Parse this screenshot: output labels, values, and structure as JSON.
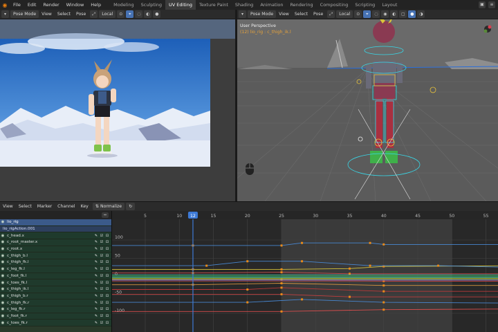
{
  "menubar": {
    "items": [
      "File",
      "Edit",
      "Render",
      "Window",
      "Help"
    ],
    "workspaces": [
      "Modeling",
      "Sculpting",
      "UV Editing",
      "Texture Paint",
      "Shading",
      "Animation",
      "Rendering",
      "Compositing",
      "Scripting",
      "Layout"
    ],
    "active_workspace": "UV Editing"
  },
  "left_viewport": {
    "mode": "Pose Mode",
    "menus": [
      "View",
      "Select",
      "Pose"
    ],
    "orientation": "Local"
  },
  "right_viewport": {
    "mode": "Pose Mode",
    "menus": [
      "View",
      "Select",
      "Pose"
    ],
    "orientation": "Local",
    "overlay_title": "User Perspective",
    "overlay_subtitle": "(12) lio_rig : c_thigh_ik.l"
  },
  "graph_editor": {
    "menus": [
      "View",
      "Select",
      "Marker",
      "Channel",
      "Key"
    ],
    "normalize_label": "Normalize",
    "current_frame": "12",
    "frame_ticks": [
      "5",
      "10",
      "12",
      "15",
      "20",
      "25",
      "30",
      "35",
      "40",
      "45",
      "50",
      "55"
    ],
    "value_ticks": [
      "100",
      "50",
      "0",
      "-50",
      "-100"
    ],
    "object": "lio_rig",
    "action": "lio_rigAction.001",
    "channels": [
      "c_head.x",
      "c_root_master.x",
      "c_root.x",
      "c_thigh_b.l",
      "c_thigh_fk.l",
      "c_leg_fk.l",
      "c_foot_fk.l",
      "c_toes_fk.l",
      "c_thigh_ik.l",
      "c_thigh_b.r",
      "c_thigh_fk.r",
      "c_leg_fk.r",
      "c_foot_fk.r",
      "c_toes_fk.r"
    ]
  },
  "colors": {
    "accent": "#4772b3",
    "frame_indicator": "#3d7ad6",
    "keyframe": "#e88a1a",
    "channel_row": "#1f3a2c"
  }
}
